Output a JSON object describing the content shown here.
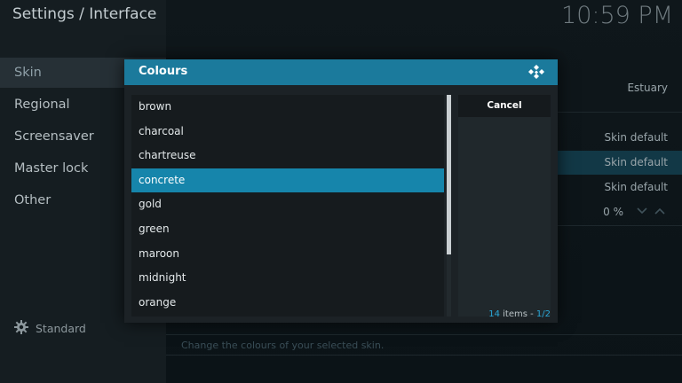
{
  "header": {
    "breadcrumb": "Settings / Interface",
    "clock": "10:59 PM"
  },
  "sidebar": {
    "items": [
      {
        "label": "Skin",
        "active": true
      },
      {
        "label": "Regional"
      },
      {
        "label": "Screensaver"
      },
      {
        "label": "Master lock"
      },
      {
        "label": "Other"
      }
    ],
    "level_label": "Standard"
  },
  "settings": {
    "rows": [
      {
        "value": "Estuary"
      },
      {
        "value": "Skin default"
      },
      {
        "value": "Skin default"
      },
      {
        "value": "Skin default"
      },
      {
        "value": "0 %"
      }
    ],
    "description": "Change the colours of your selected skin."
  },
  "dialog": {
    "title": "Colours",
    "items": [
      "brown",
      "charcoal",
      "chartreuse",
      "concrete",
      "gold",
      "green",
      "maroon",
      "midnight",
      "orange"
    ],
    "selected": "concrete",
    "cancel_label": "Cancel",
    "count_num": "14",
    "count_text": " items - ",
    "page": "1/2"
  },
  "colors": {
    "accent": "#1685ab",
    "header": "#1b7a9c"
  }
}
